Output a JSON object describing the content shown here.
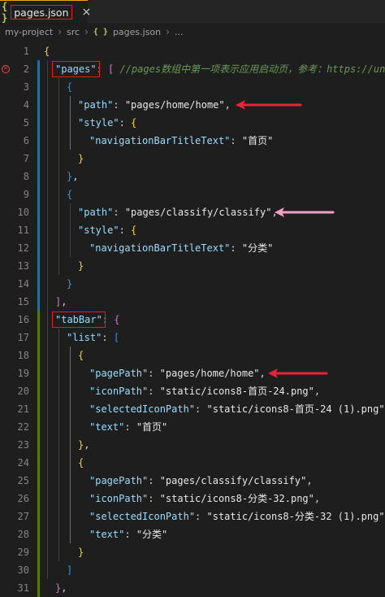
{
  "tab": {
    "icon": "{ }",
    "label": "pages.json",
    "close": "×"
  },
  "breadcrumb": {
    "items": [
      "my-project",
      "src",
      "pages.json",
      "..."
    ],
    "file_icon": "{ }"
  },
  "editor": {
    "lines": [
      {
        "n": "1",
        "tokens": [
          {
            "t": "{",
            "c": "b1"
          }
        ]
      },
      {
        "n": "2",
        "tokens": [
          {
            "t": "\"pages\"",
            "c": "k"
          },
          {
            "t": ": ",
            "c": "p"
          },
          {
            "t": "[",
            "c": "b2"
          },
          {
            "t": " ",
            "c": "p"
          },
          {
            "t": "//pages数组中第一项表示应用启动页，参考：https://uni",
            "c": "cm"
          }
        ]
      },
      {
        "n": "3",
        "tokens": [
          {
            "t": "{",
            "c": "b3"
          }
        ]
      },
      {
        "n": "4",
        "tokens": [
          {
            "t": "\"path\"",
            "c": "k"
          },
          {
            "t": ": ",
            "c": "p"
          },
          {
            "t": "\"pages/home/home\"",
            "c": "sw"
          },
          {
            "t": ",",
            "c": "p"
          }
        ]
      },
      {
        "n": "5",
        "tokens": [
          {
            "t": "\"style\"",
            "c": "k"
          },
          {
            "t": ": ",
            "c": "p"
          },
          {
            "t": "{",
            "c": "b1"
          }
        ]
      },
      {
        "n": "6",
        "tokens": [
          {
            "t": "\"navigationBarTitleText\"",
            "c": "k"
          },
          {
            "t": ": ",
            "c": "p"
          },
          {
            "t": "\"首页\"",
            "c": "sw"
          }
        ]
      },
      {
        "n": "7",
        "tokens": [
          {
            "t": "}",
            "c": "b1"
          }
        ]
      },
      {
        "n": "8",
        "tokens": [
          {
            "t": "}",
            "c": "b3"
          },
          {
            "t": ",",
            "c": "p"
          }
        ]
      },
      {
        "n": "9",
        "tokens": [
          {
            "t": "{",
            "c": "b3"
          }
        ]
      },
      {
        "n": "10",
        "tokens": [
          {
            "t": "\"path\"",
            "c": "k"
          },
          {
            "t": ": ",
            "c": "p"
          },
          {
            "t": "\"pages/classify/classify\"",
            "c": "sw"
          },
          {
            "t": ",",
            "c": "p"
          }
        ]
      },
      {
        "n": "11",
        "tokens": [
          {
            "t": "\"style\"",
            "c": "k"
          },
          {
            "t": ": ",
            "c": "p"
          },
          {
            "t": "{",
            "c": "b1"
          }
        ]
      },
      {
        "n": "12",
        "tokens": [
          {
            "t": "\"navigationBarTitleText\"",
            "c": "k"
          },
          {
            "t": ": ",
            "c": "p"
          },
          {
            "t": "\"分类\"",
            "c": "sw"
          }
        ]
      },
      {
        "n": "13",
        "tokens": [
          {
            "t": "}",
            "c": "b1"
          }
        ]
      },
      {
        "n": "14",
        "tokens": [
          {
            "t": "}",
            "c": "b3"
          }
        ]
      },
      {
        "n": "15",
        "tokens": [
          {
            "t": "]",
            "c": "b2"
          },
          {
            "t": ",",
            "c": "p"
          }
        ]
      },
      {
        "n": "16",
        "tokens": [
          {
            "t": "\"tabBar\"",
            "c": "k"
          },
          {
            "t": ": ",
            "c": "p"
          },
          {
            "t": "{",
            "c": "b2"
          }
        ]
      },
      {
        "n": "17",
        "tokens": [
          {
            "t": "\"list\"",
            "c": "k"
          },
          {
            "t": ": ",
            "c": "p"
          },
          {
            "t": "[",
            "c": "b3"
          }
        ]
      },
      {
        "n": "18",
        "tokens": [
          {
            "t": "{",
            "c": "b1"
          }
        ]
      },
      {
        "n": "19",
        "tokens": [
          {
            "t": "\"pagePath\"",
            "c": "k"
          },
          {
            "t": ": ",
            "c": "p"
          },
          {
            "t": "\"pages/home/home\"",
            "c": "sw"
          },
          {
            "t": ",",
            "c": "p"
          }
        ]
      },
      {
        "n": "20",
        "tokens": [
          {
            "t": "\"iconPath\"",
            "c": "k"
          },
          {
            "t": ": ",
            "c": "p"
          },
          {
            "t": "\"static/icons8-首页-24.png\"",
            "c": "sw"
          },
          {
            "t": ",",
            "c": "p"
          }
        ]
      },
      {
        "n": "21",
        "tokens": [
          {
            "t": "\"selectedIconPath\"",
            "c": "k"
          },
          {
            "t": ": ",
            "c": "p"
          },
          {
            "t": "\"static/icons8-首页-24 (1).png\"",
            "c": "sw"
          },
          {
            "t": ",",
            "c": "p"
          }
        ]
      },
      {
        "n": "22",
        "tokens": [
          {
            "t": "\"text\"",
            "c": "k"
          },
          {
            "t": ": ",
            "c": "p"
          },
          {
            "t": "\"首页\"",
            "c": "sw"
          }
        ]
      },
      {
        "n": "23",
        "tokens": [
          {
            "t": "}",
            "c": "b1"
          },
          {
            "t": ",",
            "c": "p"
          }
        ]
      },
      {
        "n": "24",
        "tokens": [
          {
            "t": "{",
            "c": "b1"
          }
        ]
      },
      {
        "n": "25",
        "tokens": [
          {
            "t": "\"pagePath\"",
            "c": "k"
          },
          {
            "t": ": ",
            "c": "p"
          },
          {
            "t": "\"pages/classify/classify\"",
            "c": "sw"
          },
          {
            "t": ",",
            "c": "p"
          }
        ]
      },
      {
        "n": "26",
        "tokens": [
          {
            "t": "\"iconPath\"",
            "c": "k"
          },
          {
            "t": ": ",
            "c": "p"
          },
          {
            "t": "\"static/icons8-分类-32.png\"",
            "c": "sw"
          },
          {
            "t": ",",
            "c": "p"
          }
        ]
      },
      {
        "n": "27",
        "tokens": [
          {
            "t": "\"selectedIconPath\"",
            "c": "k"
          },
          {
            "t": ": ",
            "c": "p"
          },
          {
            "t": "\"static/icons8-分类-32 (1).png\"",
            "c": "sw"
          },
          {
            "t": ",",
            "c": "p"
          }
        ]
      },
      {
        "n": "28",
        "tokens": [
          {
            "t": "\"text\"",
            "c": "k"
          },
          {
            "t": ": ",
            "c": "p"
          },
          {
            "t": "\"分类\"",
            "c": "sw"
          }
        ]
      },
      {
        "n": "29",
        "tokens": [
          {
            "t": "}",
            "c": "b1"
          }
        ]
      },
      {
        "n": "30",
        "tokens": [
          {
            "t": "]",
            "c": "b3"
          }
        ]
      },
      {
        "n": "31",
        "tokens": [
          {
            "t": "}",
            "c": "b2"
          },
          {
            "t": ",",
            "c": "p"
          }
        ]
      }
    ]
  },
  "colors": {
    "highlight_box": "#e11d1d",
    "arrow_red": "#e8243a",
    "arrow_pink": "#f0a0c8",
    "error": "#f14c4c"
  },
  "icons": {
    "error": "error-icon",
    "file": "json-file-icon",
    "close": "close-icon"
  }
}
